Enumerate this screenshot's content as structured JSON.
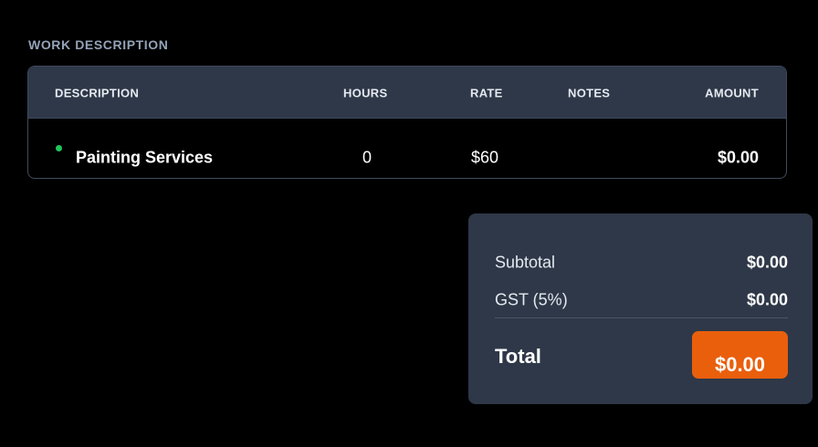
{
  "section": {
    "title": "WORK DESCRIPTION"
  },
  "table": {
    "headers": {
      "description": "DESCRIPTION",
      "hours": "HOURS",
      "rate": "RATE",
      "notes": "NOTES",
      "amount": "AMOUNT"
    },
    "rows": [
      {
        "description": "Painting Services",
        "hours": "0",
        "rate": "$60",
        "notes": "",
        "amount": "$0.00",
        "status_color": "#22c55e"
      }
    ]
  },
  "summary": {
    "subtotal_label": "Subtotal",
    "subtotal_value": "$0.00",
    "gst_label": "GST (5%)",
    "gst_value": "$0.00",
    "total_label": "Total",
    "total_value": "$0.00",
    "accent_color": "#ea5f0c"
  }
}
